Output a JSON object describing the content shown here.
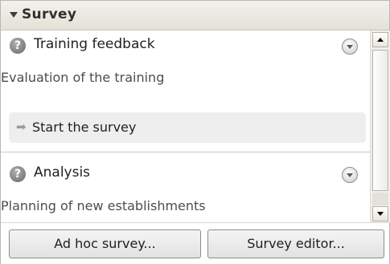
{
  "panel": {
    "title": "Survey",
    "collapse_icon": "triangle-down-icon"
  },
  "surveys": [
    {
      "icon": "help-question-icon",
      "icon_glyph": "?",
      "title": "Training feedback",
      "description": "Evaluation of the training",
      "menu_icon": "chevron-down-circle-icon",
      "action": {
        "icon": "arrow-right-icon",
        "icon_glyph": "➡",
        "label": "Start the survey"
      }
    },
    {
      "icon": "help-question-icon",
      "icon_glyph": "?",
      "title": "Analysis",
      "description": "Planning of new establishments",
      "menu_icon": "chevron-down-circle-icon"
    }
  ],
  "footer": {
    "ad_hoc_label": "Ad hoc survey...",
    "editor_label": "Survey editor..."
  },
  "colors": {
    "header_bg": "#e4e1d8",
    "action_bg": "#eeeeee",
    "icon_gray": "#8a8a8a"
  }
}
